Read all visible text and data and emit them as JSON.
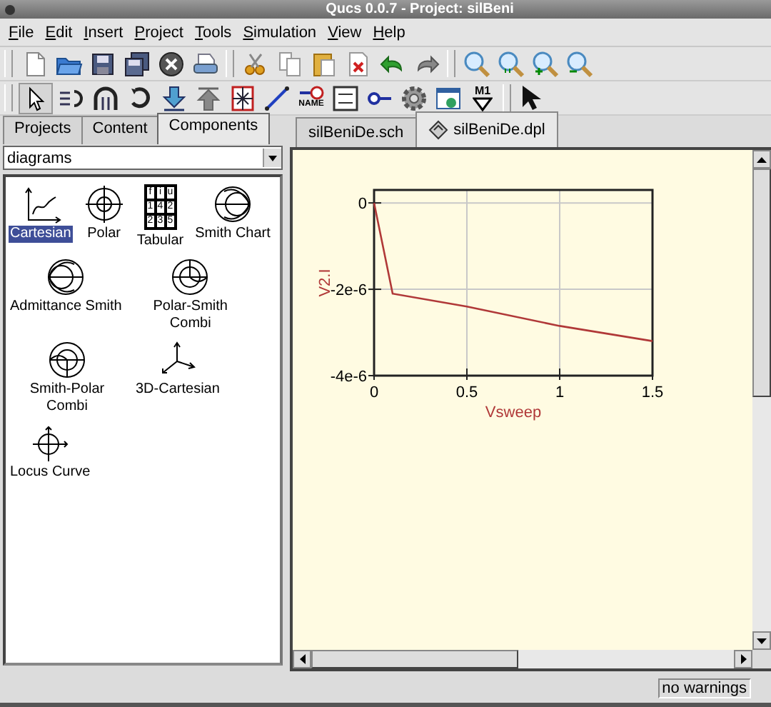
{
  "window": {
    "title": "Qucs 0.0.7 - Project: silBeni"
  },
  "menu": [
    "File",
    "Edit",
    "Insert",
    "Project",
    "Tools",
    "Simulation",
    "View",
    "Help"
  ],
  "toolbar_2": {
    "label_icon_text": "NAME",
    "marker_icon_text": "M1"
  },
  "side_tabs": [
    {
      "label": "Projects",
      "selected": false
    },
    {
      "label": "Content",
      "selected": false
    },
    {
      "label": "Components",
      "selected": true
    }
  ],
  "category_dropdown": {
    "value": "diagrams"
  },
  "components": [
    {
      "kind": "cartesian",
      "label": "Cartesian",
      "selected": true
    },
    {
      "kind": "polar",
      "label": "Polar",
      "selected": false
    },
    {
      "kind": "tabular",
      "label": "Tabular",
      "selected": false,
      "cells": [
        "f",
        "i",
        "u",
        "1",
        "4",
        "2",
        "2",
        "3",
        "5"
      ]
    },
    {
      "kind": "smith",
      "label": "Smith Chart",
      "selected": false
    },
    {
      "kind": "admittance",
      "label": "Admittance Smith",
      "selected": false
    },
    {
      "kind": "polar-smith",
      "label": "Polar-Smith Combi",
      "selected": false
    },
    {
      "kind": "smith-polar",
      "label": "Smith-Polar Combi",
      "selected": false
    },
    {
      "kind": "cartesian3d",
      "label": "3D-Cartesian",
      "selected": false
    },
    {
      "kind": "locus",
      "label": "Locus Curve",
      "selected": false
    }
  ],
  "doc_tabs": [
    {
      "label": "silBeniDe.sch",
      "kind": "schematic",
      "selected": false
    },
    {
      "label": "silBeniDe.dpl",
      "kind": "display",
      "selected": true
    }
  ],
  "diagram": {
    "chart_data": {
      "type": "line",
      "xlabel": "Vsweep",
      "ylabel": "V2.I",
      "x": [
        0,
        0.1,
        0.5,
        1,
        1.5
      ],
      "series": [
        {
          "color": "#b03838",
          "values": [
            0,
            -2.1e-06,
            -2.4e-06,
            -2.85e-06,
            -3.2e-06
          ]
        }
      ],
      "grid": true,
      "xlim": [
        0,
        1.5
      ],
      "ylim": [
        -4e-06,
        3e-07
      ],
      "xticks": [
        0,
        0.5,
        1,
        1.5
      ],
      "yticks": [
        {
          "value": 0,
          "label": "0"
        },
        {
          "value": -2e-06,
          "label": "-2e-6"
        },
        {
          "value": -4e-06,
          "label": "-4e-6"
        }
      ]
    }
  },
  "status_bar": {
    "message": "no warnings"
  }
}
